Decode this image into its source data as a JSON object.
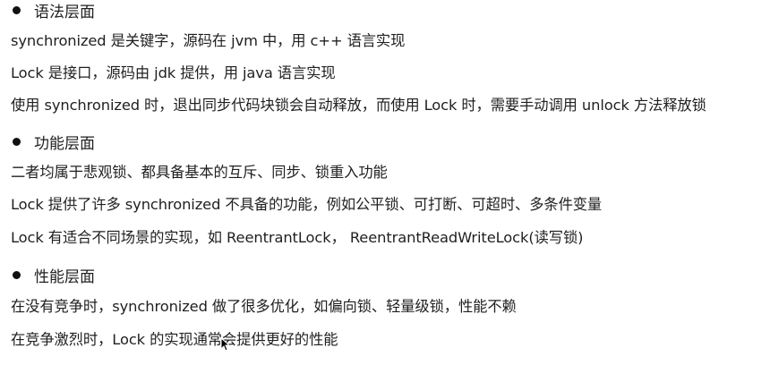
{
  "sections": [
    {
      "heading": "语法层面",
      "lines": [
        "synchronized 是关键字，源码在 jvm 中，用 c++ 语言实现",
        "Lock 是接口，源码由 jdk 提供，用 java 语言实现",
        "使用 synchronized 时，退出同步代码块锁会自动释放，而使用 Lock 时，需要手动调用 unlock 方法释放锁"
      ]
    },
    {
      "heading": "功能层面",
      "lines": [
        "二者均属于悲观锁、都具备基本的互斥、同步、锁重入功能",
        "Lock 提供了许多 synchronized 不具备的功能，例如公平锁、可打断、可超时、多条件变量",
        "Lock 有适合不同场景的实现，如 ReentrantLock， ReentrantReadWriteLock(读写锁)"
      ]
    },
    {
      "heading": "性能层面",
      "lines": [
        "在没有竞争时，synchronized 做了很多优化，如偏向锁、轻量级锁，性能不赖",
        "在竞争激烈时，Lock 的实现通常会提供更好的性能"
      ]
    }
  ],
  "icons": {
    "bullet": "filled-circle",
    "cursor": "mouse-pointer-icon"
  }
}
